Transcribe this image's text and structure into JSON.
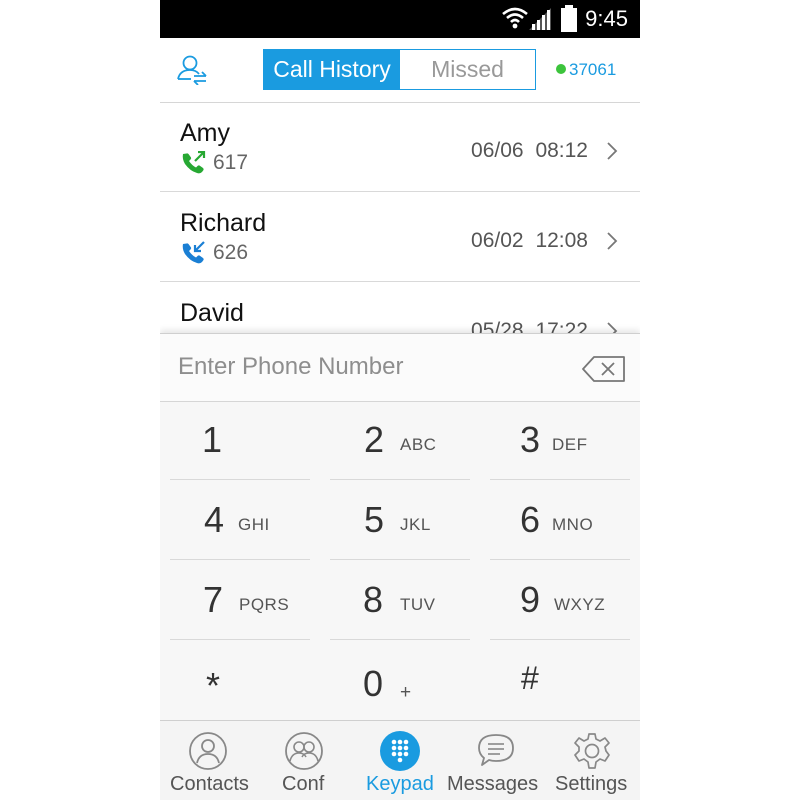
{
  "status_bar": {
    "time": "9:45",
    "icons": [
      "wifi-icon",
      "signal-icon",
      "battery-icon"
    ]
  },
  "header": {
    "switch_icon": "contact-switch-icon",
    "tabs": [
      {
        "label": "Call History",
        "active": true
      },
      {
        "label": "Missed",
        "active": false
      }
    ],
    "status": {
      "extension": "37061",
      "status_color": "#3cc43c"
    }
  },
  "call_history": [
    {
      "name": "Amy",
      "number": "617",
      "direction": "outgoing",
      "icon": "outgoing-call-icon",
      "icon_color": "#27a833",
      "date": "06/06",
      "time": "08:12"
    },
    {
      "name": "Richard",
      "number": "626",
      "direction": "incoming",
      "icon": "incoming-call-icon",
      "icon_color": "#1a7fd4",
      "date": "06/02",
      "time": "12:08"
    },
    {
      "name": "David",
      "number": "",
      "direction": "incoming",
      "icon": "incoming-call-icon",
      "icon_color": "#1a7fd4",
      "date": "05/28",
      "time": "17:22"
    }
  ],
  "dialer": {
    "input": {
      "placeholder": "Enter Phone Number",
      "value": ""
    },
    "backspace_icon": "backspace-icon",
    "keys": [
      {
        "digit": "1",
        "letters": ""
      },
      {
        "digit": "2",
        "letters": "ABC"
      },
      {
        "digit": "3",
        "letters": "DEF"
      },
      {
        "digit": "4",
        "letters": "GHI"
      },
      {
        "digit": "5",
        "letters": "JKL"
      },
      {
        "digit": "6",
        "letters": "MNO"
      },
      {
        "digit": "7",
        "letters": "PQRS"
      },
      {
        "digit": "8",
        "letters": "TUV"
      },
      {
        "digit": "9",
        "letters": "WXYZ"
      },
      {
        "digit": "*",
        "letters": ""
      },
      {
        "digit": "0",
        "letters": "+"
      },
      {
        "digit": "#",
        "letters": ""
      }
    ]
  },
  "tab_bar": [
    {
      "label": "Contacts",
      "icon": "contacts-icon",
      "active": false
    },
    {
      "label": "Conf",
      "icon": "conference-icon",
      "active": false
    },
    {
      "label": "Keypad",
      "icon": "keypad-icon",
      "active": true
    },
    {
      "label": "Messages",
      "icon": "messages-icon",
      "active": false
    },
    {
      "label": "Settings",
      "icon": "settings-icon",
      "active": false
    }
  ],
  "colors": {
    "accent": "#1a9be0",
    "outgoing": "#27a833",
    "incoming": "#1a7fd4",
    "status_bar": "#000000"
  }
}
